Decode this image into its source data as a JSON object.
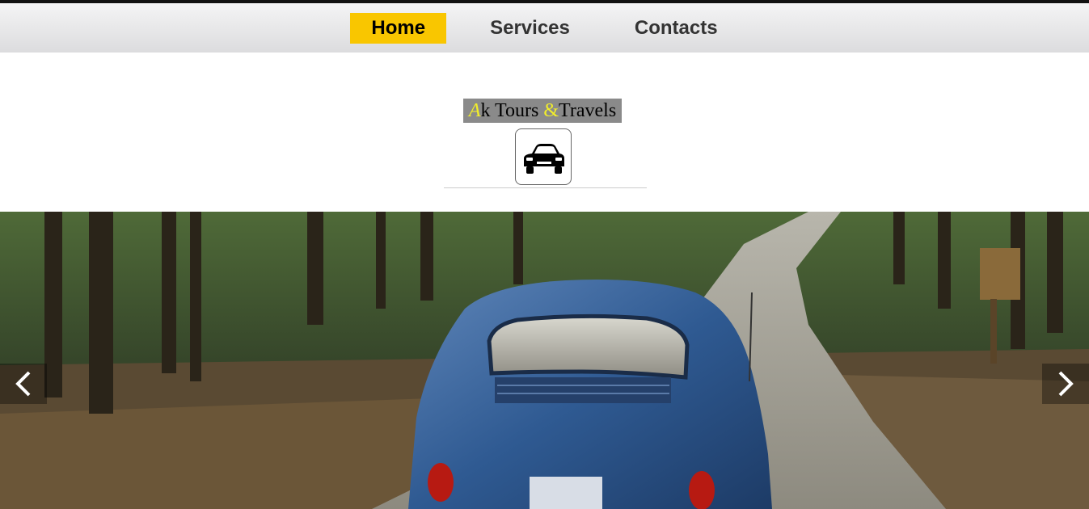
{
  "nav": {
    "items": [
      {
        "label": "Home",
        "active": true
      },
      {
        "label": "Services",
        "active": false
      },
      {
        "label": "Contacts",
        "active": false
      }
    ],
    "active_color": "#f9c600"
  },
  "brand": {
    "title_first_letter": "A",
    "title_part1": "k Tours ",
    "title_ampersand": "&",
    "title_part2": "Travels",
    "logo_icon": "car-icon"
  },
  "hero": {
    "image": "blue-vintage-car-on-forest-road",
    "prev_icon": "chevron-left-icon",
    "next_icon": "chevron-right-icon"
  }
}
